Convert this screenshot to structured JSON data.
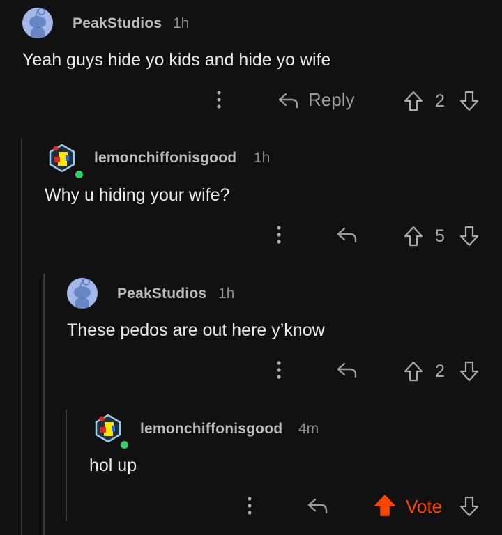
{
  "colors": {
    "background": "#111112",
    "upvote_active": "#ff4500",
    "online": "#2fd068"
  },
  "comments": [
    {
      "username": "PeakStudios",
      "time": "1h",
      "text": "Yeah guys hide yo kids and hide yo wife",
      "reply_label": "Reply",
      "score": "2",
      "avatar": "default-snoo-avatar"
    },
    {
      "username": "lemonchiffonisgood",
      "time": "1h",
      "text": "Why u hiding your wife?",
      "score": "5",
      "avatar": "custom-avatar"
    },
    {
      "username": "PeakStudios",
      "time": "1h",
      "text": "These pedos are out here y’know",
      "score": "2",
      "avatar": "default-snoo-avatar"
    },
    {
      "username": "lemonchiffonisgood",
      "time": "4m",
      "text": "hol up",
      "vote_label": "Vote",
      "upvoted": true,
      "avatar": "custom-avatar"
    }
  ]
}
